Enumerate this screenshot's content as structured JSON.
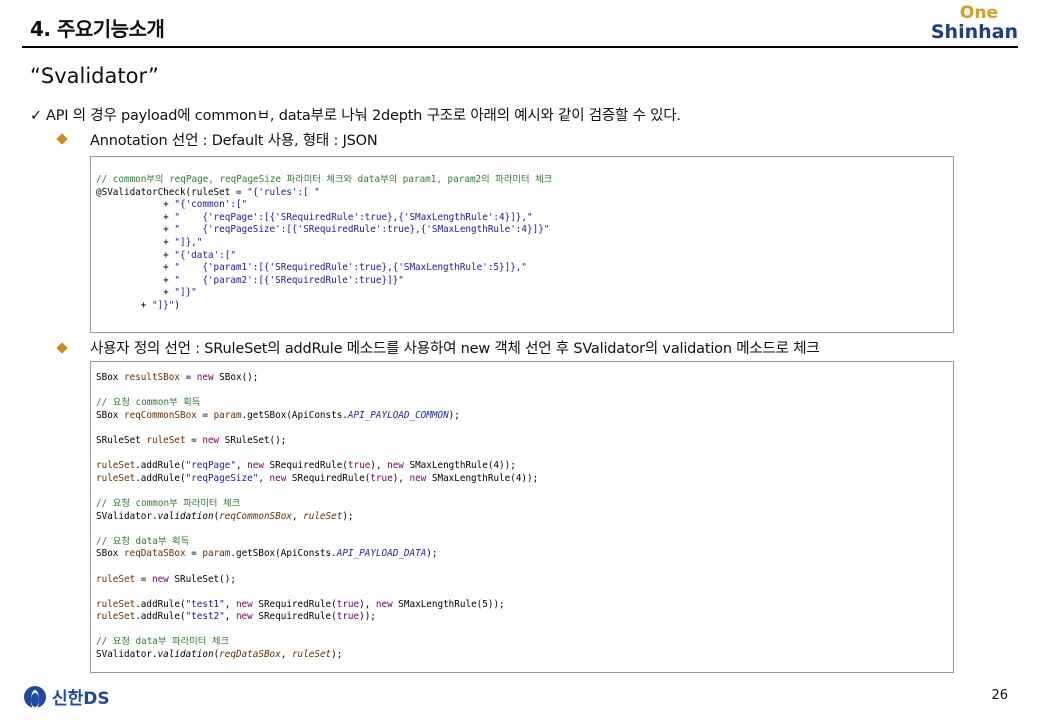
{
  "header": {
    "title": "4. 주요기능소개",
    "logo_top": "One",
    "logo_bottom": "Shinhan"
  },
  "section_title": "“Svalidator”",
  "intro": "API 의 경우 payload에 commonㅂ, data부로 나눠 2depth 구조로 아래의 예시와 같이 검증할 수 있다.",
  "bullets": [
    {
      "text": "Annotation 선언 : Default 사용,  형태 : JSON"
    },
    {
      "text": "사용자 정의 선언 : SRuleSet의 addRule 메소드를 사용하여 new 객체 선언 후 SValidator의 validation 메소드로 체크"
    }
  ],
  "code1": {
    "comment": "// common부의 reqPage, reqPageSize 파라미터 체크와 data부의 param1, param2의 파라미터 체크",
    "l1_a": "@SValidatorCheck(ruleSet = ",
    "l1_b": "\"{'rules':[ \"",
    "l2_a": "            + ",
    "l2_b": "\"{'common':[\"",
    "l3_a": "            + ",
    "l3_b": "\"    {'reqPage':[{'SRequiredRule':true},{'SMaxLengthRule':4}]},\"",
    "l4_a": "            + ",
    "l4_b": "\"    {'reqPageSize':[{'SRequiredRule':true},{'SMaxLengthRule':4}]}\"",
    "l5_a": "            + ",
    "l5_b": "\"]},\"",
    "l6_a": "            + ",
    "l6_b": "\"{'data':[\"",
    "l7_a": "            + ",
    "l7_b": "\"    {'param1':[{'SRequiredRule':true},{'SMaxLengthRule':5}]},\"",
    "l8_a": "            + ",
    "l8_b": "\"    {'param2':[{'SRequiredRule':true}]}\"",
    "l9_a": "            + ",
    "l9_b": "\"]}\"",
    "l10_a": "        + ",
    "l10_b": "\"]}\"",
    "l10_c": ")"
  },
  "code2": {
    "l1_a": "SBox ",
    "l1_b": "resultSBox",
    "l1_c": " = ",
    "l1_d": "new",
    "l1_e": " SBox();",
    "cmt1": "// 요청 common부 획득",
    "l2_a": "SBox ",
    "l2_b": "reqCommonSBox",
    "l2_c": " = ",
    "l2_d": "param",
    "l2_e": ".getSBox(ApiConsts.",
    "l2_f": "API_PAYLOAD_COMMON",
    "l2_g": ");",
    "l3_a": "SRuleSet ",
    "l3_b": "ruleSet",
    "l3_c": " = ",
    "l3_d": "new",
    "l3_e": " SRuleSet();",
    "l4_a": "ruleSet",
    "l4_b": ".addRule(",
    "l4_c": "\"reqPage\"",
    "l4_d": ", ",
    "l4_e": "new",
    "l4_f": " SRequiredRule(",
    "l4_g": "true",
    "l4_h": "), ",
    "l4_i": "new",
    "l4_j": " SMaxLengthRule(4));",
    "l5_a": "ruleSet",
    "l5_b": ".addRule(",
    "l5_c": "\"reqPageSize\"",
    "l5_d": ", ",
    "l5_e": "new",
    "l5_f": " SRequiredRule(",
    "l5_g": "true",
    "l5_h": "), ",
    "l5_i": "new",
    "l5_j": " SMaxLengthRule(4));",
    "cmt2": "// 요청 common부 파라미터 체크",
    "l6_a": "SValidator.",
    "l6_b": "validation",
    "l6_c": "(",
    "l6_d": "reqCommonSBox",
    "l6_e": ", ",
    "l6_f": "ruleSet",
    "l6_g": ");",
    "cmt3": "// 요청 data부 획득",
    "l7_a": "SBox ",
    "l7_b": "reqDataSBox",
    "l7_c": " = ",
    "l7_d": "param",
    "l7_e": ".getSBox(ApiConsts.",
    "l7_f": "API_PAYLOAD_DATA",
    "l7_g": ");",
    "l8_a": "ruleSet",
    "l8_b": " = ",
    "l8_c": "new",
    "l8_d": " SRuleSet();",
    "l9_a": "ruleSet",
    "l9_b": ".addRule(",
    "l9_c": "\"test1\"",
    "l9_d": ", ",
    "l9_e": "new",
    "l9_f": " SRequiredRule(",
    "l9_g": "true",
    "l9_h": "), ",
    "l9_i": "new",
    "l9_j": " SMaxLengthRule(5));",
    "l10_a": "ruleSet",
    "l10_b": ".addRule(",
    "l10_c": "\"test2\"",
    "l10_d": ", ",
    "l10_e": "new",
    "l10_f": " SRequiredRule(",
    "l10_g": "true",
    "l10_h": "));",
    "cmt4": "// 요청 data부 파라미터 체크",
    "l11_a": "SValidator.",
    "l11_b": "validation",
    "l11_c": "(",
    "l11_d": "reqDataSBox",
    "l11_e": ", ",
    "l11_f": "ruleSet",
    "l11_g": ");"
  },
  "footer": {
    "logo_text": "신한DS",
    "page_number": "26"
  },
  "colors": {
    "accent_diamond": "#c98a1e",
    "logo_one": "#d89b28",
    "logo_shinhan": "#1a3d8c",
    "code_comment": "#2e7d32",
    "code_string": "#1a1aa6",
    "code_keyword": "#7a0060"
  },
  "icons": [
    "checkmark-icon",
    "diamond-bullet-icon",
    "shinhan-emblem-icon"
  ]
}
